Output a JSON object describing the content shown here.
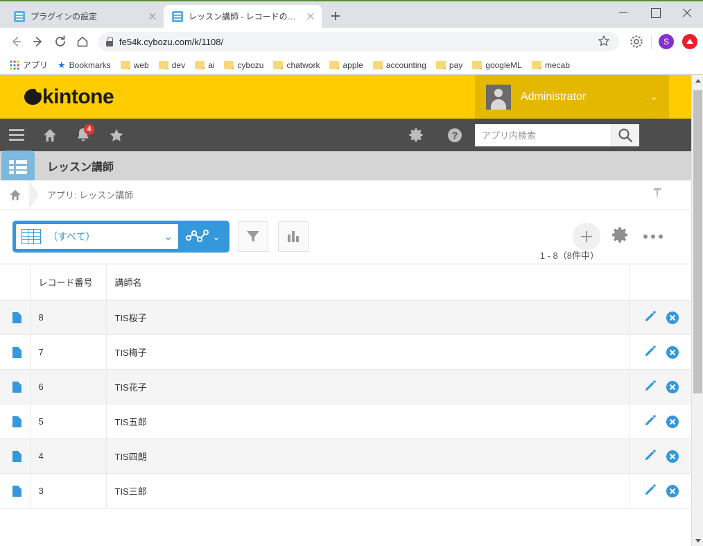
{
  "browser": {
    "tabs": [
      {
        "title": "プラグインの設定",
        "active": false
      },
      {
        "title": "レッスン講師 - レコードの一覧",
        "active": true
      }
    ],
    "url": "fe54k.cybozu.com/k/1108/",
    "profile_initial": "S",
    "bookmarks": [
      {
        "label": "アプリ",
        "icon": "apps-grid-icon"
      },
      {
        "label": "Bookmarks",
        "icon": "star-icon"
      },
      {
        "label": "web",
        "icon": "folder-icon"
      },
      {
        "label": "dev",
        "icon": "folder-icon"
      },
      {
        "label": "ai",
        "icon": "folder-icon"
      },
      {
        "label": "cybozu",
        "icon": "folder-icon"
      },
      {
        "label": "chatwork",
        "icon": "folder-icon"
      },
      {
        "label": "apple",
        "icon": "folder-icon"
      },
      {
        "label": "accounting",
        "icon": "folder-icon"
      },
      {
        "label": "pay",
        "icon": "folder-icon"
      },
      {
        "label": "googleML",
        "icon": "folder-icon"
      },
      {
        "label": "mecab",
        "icon": "folder-icon"
      }
    ]
  },
  "kintone": {
    "brand": "kintone",
    "brand_color": "#FFCC00",
    "accent_color": "#3498DB",
    "user_name": "Administrator",
    "notification_count": "4",
    "search_placeholder": "アプリ内検索",
    "app_name": "レッスン講師",
    "breadcrumb": "アプリ: レッスン講師",
    "view_name": "（すべて）",
    "record_count": "1 - 8（8件中）"
  },
  "table": {
    "columns": [
      "レコード番号",
      "講師名"
    ],
    "rows": [
      {
        "no": "8",
        "name": "TIS桜子"
      },
      {
        "no": "7",
        "name": "TIS梅子"
      },
      {
        "no": "6",
        "name": "TIS花子"
      },
      {
        "no": "5",
        "name": "TIS五郎"
      },
      {
        "no": "4",
        "name": "TIS四朗"
      },
      {
        "no": "3",
        "name": "TIS三郎"
      }
    ]
  }
}
